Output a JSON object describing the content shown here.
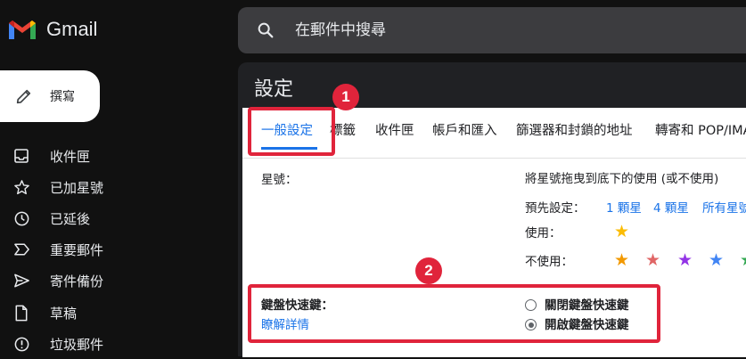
{
  "app": {
    "name": "Gmail"
  },
  "compose": {
    "label": "撰寫"
  },
  "nav": [
    {
      "label": "收件匣",
      "icon": "inbox-icon"
    },
    {
      "label": "已加星號",
      "icon": "star-icon"
    },
    {
      "label": "已延後",
      "icon": "clock-icon"
    },
    {
      "label": "重要郵件",
      "icon": "important-icon"
    },
    {
      "label": "寄件備份",
      "icon": "send-icon"
    },
    {
      "label": "草稿",
      "icon": "draft-icon"
    },
    {
      "label": "垃圾郵件",
      "icon": "spam-icon"
    }
  ],
  "search": {
    "placeholder": "在郵件中搜尋"
  },
  "settings": {
    "title": "設定",
    "tabs": [
      "一般設定",
      "標籤",
      "收件匣",
      "帳戶和匯入",
      "篩選器和封鎖的地址",
      "轉寄和 POP/IMAP"
    ],
    "stars": {
      "label": "星號：",
      "description": "將星號拖曳到底下的使用 (或不使用)",
      "presets_label": "預先設定：",
      "presets": [
        "1 顆星",
        "4 顆星",
        "所有星號"
      ],
      "in_use_label": "使用：",
      "not_in_use_label": "不使用："
    },
    "shortcuts": {
      "label": "鍵盤快速鍵：",
      "learn_more": "瞭解詳情",
      "option_off": "關閉鍵盤快速鍵",
      "option_on": "開啟鍵盤快速鍵",
      "selected": "on"
    }
  },
  "annotations": {
    "badge1": "1",
    "badge2": "2",
    "color": "#e0243b"
  },
  "colors": {
    "star_yellow": "#fbbc04",
    "star_orange": "#f29900",
    "star_red": "#e06666",
    "star_purple": "#9334e6",
    "star_blue": "#4285f4",
    "star_green": "#34a853"
  }
}
